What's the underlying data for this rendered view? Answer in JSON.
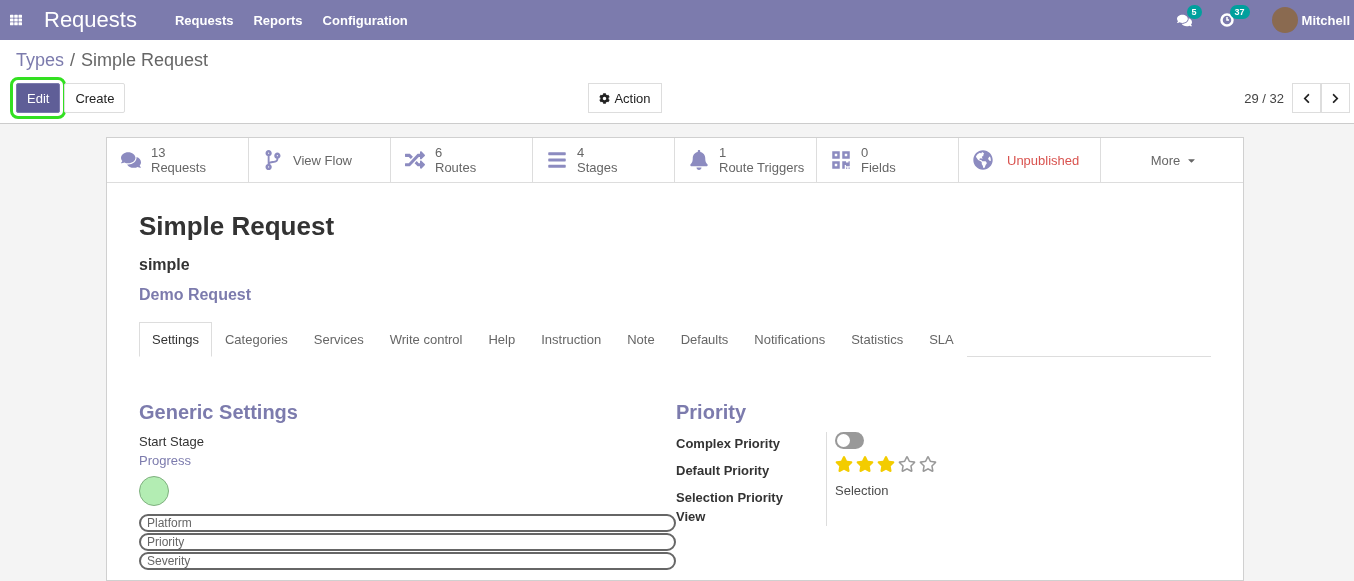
{
  "navbar": {
    "app": "Requests",
    "menu": [
      "Requests",
      "Reports",
      "Configuration"
    ],
    "messages_count": "5",
    "activities_count": "37",
    "user": "Mitchell"
  },
  "breadcrumb": {
    "parent": "Types",
    "separator": "/",
    "current": "Simple Request"
  },
  "buttons": [
    {
      "label": "Edit",
      "kind": "primary",
      "highlighted": true
    },
    {
      "label": "Create",
      "kind": "secondary",
      "highlighted": false
    }
  ],
  "action": "Action",
  "pager": {
    "text": "29 / 32"
  },
  "smart_buttons": [
    {
      "kind": "comments",
      "value": "13",
      "label": "Requests"
    },
    {
      "kind": "branch",
      "label": "View Flow"
    },
    {
      "kind": "shuffle",
      "value": "6",
      "label": "Routes"
    },
    {
      "kind": "bars",
      "value": "4",
      "label": "Stages"
    },
    {
      "kind": "bell",
      "value": "1",
      "label": "Route Triggers"
    },
    {
      "kind": "qrcode",
      "value": "0",
      "label": "Fields"
    },
    {
      "kind": "globe",
      "label": "Unpublished"
    },
    {
      "kind": "more",
      "label": "More"
    }
  ],
  "record": {
    "title": "Simple Request",
    "code": "simple",
    "service": "Demo Request"
  },
  "tabs": [
    {
      "label": "Settings",
      "selected": true
    },
    {
      "label": "Categories",
      "selected": false
    },
    {
      "label": "Services",
      "selected": false
    },
    {
      "label": "Write control",
      "selected": false
    },
    {
      "label": "Help",
      "selected": false
    },
    {
      "label": "Instruction",
      "selected": false
    },
    {
      "label": "Note",
      "selected": false
    },
    {
      "label": "Defaults",
      "selected": false
    },
    {
      "label": "Notifications",
      "selected": false
    },
    {
      "label": "Statistics",
      "selected": false
    },
    {
      "label": "SLA",
      "selected": false
    }
  ],
  "generic_settings": {
    "title": "Generic Settings",
    "start_stage_label": "Start Stage",
    "start_stage": "Progress",
    "tags": [
      "Platform",
      "Priority",
      "Severity"
    ]
  },
  "priority": {
    "title": "Priority",
    "complex_label": "Complex Priority",
    "complex_on": false,
    "default_label": "Default Priority",
    "stars": 3,
    "selection_label": "Selection Priority View",
    "selection_value": "Selection"
  }
}
